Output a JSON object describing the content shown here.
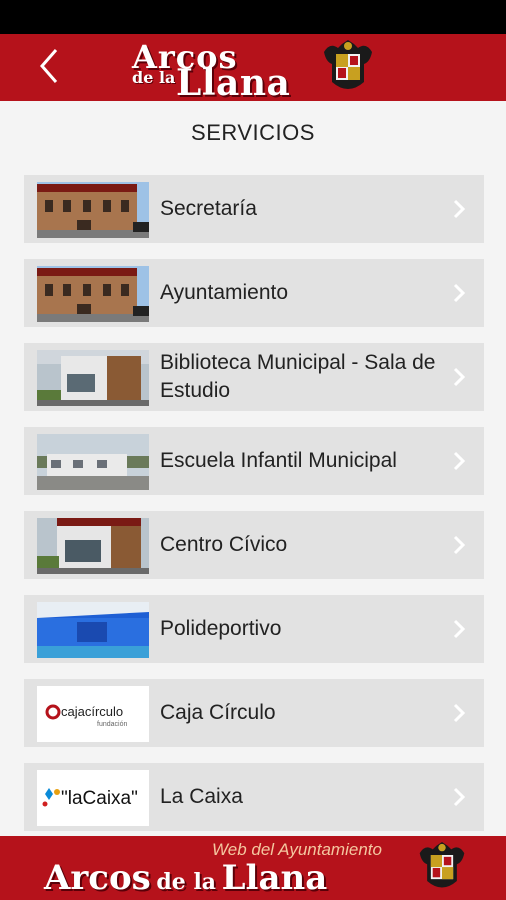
{
  "header": {
    "logo_line1": "Arcos",
    "logo_line2": "de la",
    "logo_line3": "Llana",
    "back_icon": "chevron-left-icon",
    "crest_icon": "coat-of-arms-icon"
  },
  "page_title": "SERVICIOS",
  "services": [
    {
      "label": "Secretaría",
      "thumb": "town-hall-photo"
    },
    {
      "label": "Ayuntamiento",
      "thumb": "town-hall-photo"
    },
    {
      "label": "Biblioteca Municipal - Sala de Estudio",
      "thumb": "library-photo"
    },
    {
      "label": "Escuela Infantil Municipal",
      "thumb": "school-photo"
    },
    {
      "label": "Centro Cívico",
      "thumb": "civic-center-photo"
    },
    {
      "label": "Polideportivo",
      "thumb": "sports-hall-photo"
    },
    {
      "label": "Caja Círculo",
      "thumb": "cajacirculo-logo",
      "logo_text": "cajacírculo",
      "logo_sub": "fundación"
    },
    {
      "label": "La Caixa",
      "thumb": "lacaixa-logo",
      "logo_text": "\"laCaixa\""
    }
  ],
  "footer": {
    "tagline": "Web del Ayuntamiento",
    "name_arcos": "Arcos",
    "name_dela": "de la",
    "name_llana": "Llana"
  },
  "colors": {
    "brand_red": "#b5121b",
    "item_bg": "#e2e2e2",
    "background": "#f4f4f4"
  }
}
